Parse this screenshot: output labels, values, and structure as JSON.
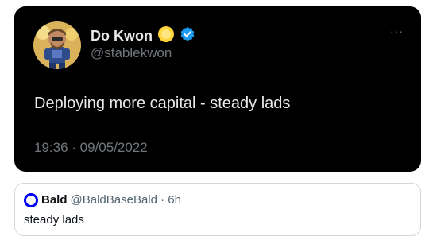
{
  "tweet": {
    "display_name": "Do Kwon",
    "handle": "@stablekwon",
    "text": "Deploying more capital - steady lads",
    "timestamp": "19:36 · 09/05/2022",
    "name_emoji_icon": "sun-emoji-icon",
    "verified_icon": "verified-badge-icon",
    "more_icon": "more-options-icon",
    "more_glyph": "···",
    "colors": {
      "card_bg": "#000000",
      "text": "#e7e9ea",
      "muted": "#71767b",
      "verified": "#1d9bf0",
      "emoji": "#ffd43b"
    }
  },
  "quote": {
    "name": "Bald",
    "handle_time": "@BaldBaseBald · 6h",
    "text": "steady lads",
    "avatar_icon": "blue-ring-avatar-icon",
    "colors": {
      "border": "#cfd9de",
      "avatar_ring": "#0000ff",
      "text": "#0f1419",
      "muted": "#536471"
    }
  }
}
